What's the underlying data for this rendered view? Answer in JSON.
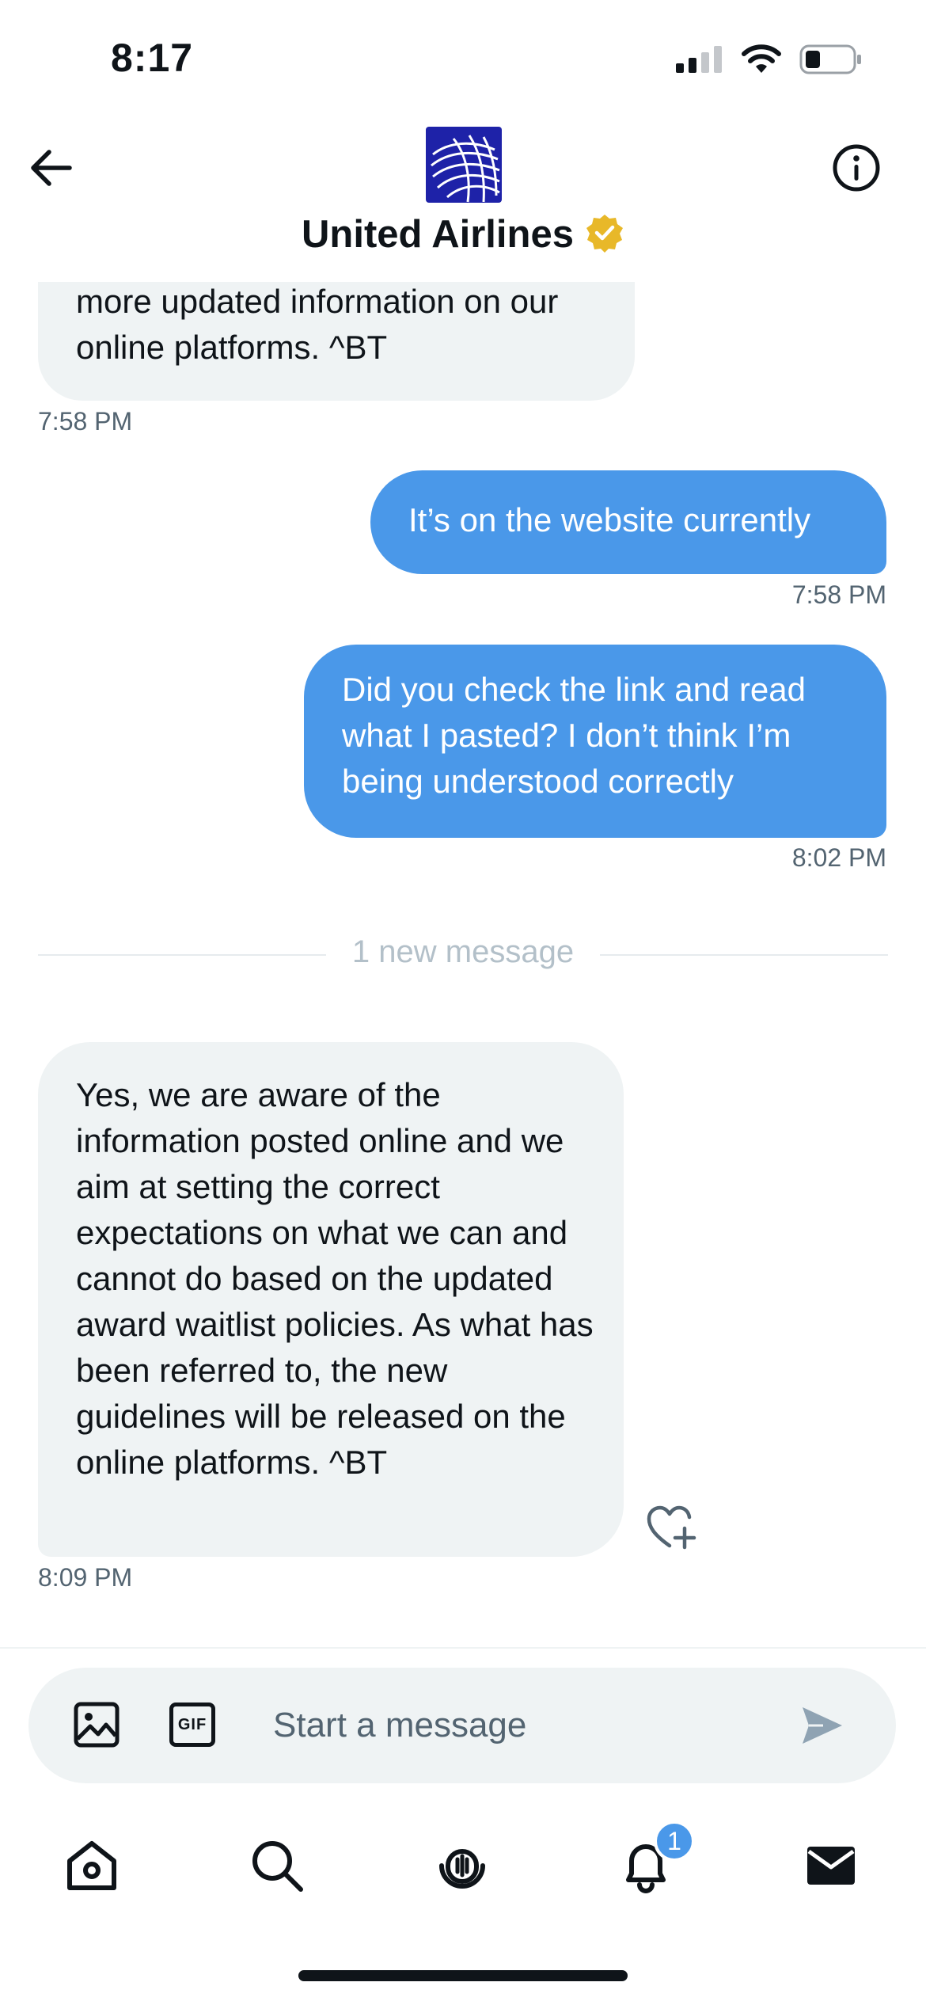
{
  "status_bar": {
    "time": "8:17"
  },
  "header": {
    "title": "United Airlines",
    "verified": true
  },
  "messages": [
    {
      "direction": "incoming",
      "text": "more updated information on our online platforms. ^BT",
      "time": "7:58 PM"
    },
    {
      "direction": "outgoing",
      "text": "It’s on the website currently",
      "time": "7:58 PM"
    },
    {
      "direction": "outgoing",
      "text": "Did you check the link and read what I pasted? I don’t think I’m being understood correctly",
      "time": "8:02 PM"
    },
    {
      "direction": "incoming",
      "text": "Yes, we are aware of the information posted online and we aim at setting the correct expectations on what we can and cannot do based on the updated award waitlist policies. As what has been referred to, the new guidelines will be released on the online platforms. ^BT",
      "time": "8:09 PM"
    }
  ],
  "new_message_separator": "1 new message",
  "composer": {
    "placeholder": "Start a message",
    "gif_label": "GIF"
  },
  "tab_bar": {
    "items": [
      "home-icon",
      "search-icon",
      "spaces-icon",
      "notifications-icon",
      "messages-icon"
    ],
    "notifications_badge": "1"
  },
  "colors": {
    "outgoing_bubble": "#4a98e9",
    "incoming_bubble": "#eff3f4",
    "brand_navy": "#1e22a8",
    "verified_gold": "#e8b829"
  }
}
